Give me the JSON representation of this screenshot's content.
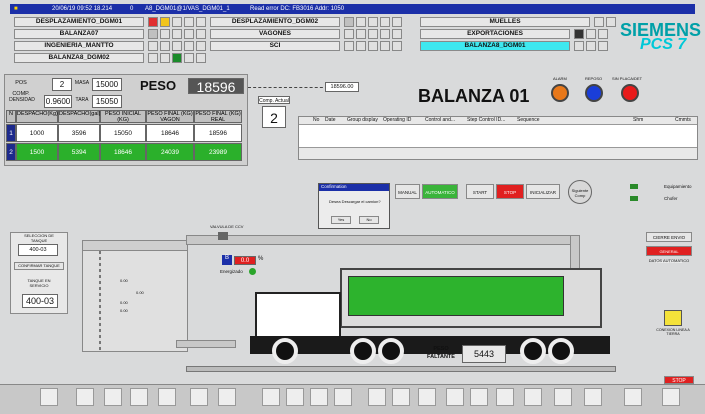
{
  "topbar": {
    "datetime": "20/06/19  09:52 18.214",
    "code": "0",
    "tag": "A8_DGM01@1/VAS_DGM01_1",
    "error": "Read error DC: FB3016 Addr: 1050"
  },
  "nav": {
    "b1": "DESPLAZAMIENTO_DGM01",
    "b2": "DESPLAZAMIENTO_DGM02",
    "b3": "MUELLES",
    "b4": "BALANZA07",
    "b5": "VAGONES",
    "b6": "EXPORTACIONES",
    "b7": "INGENIERIA_MANTTO",
    "b8": "SCI",
    "b9": "BALANZA8_DGM01",
    "b10": "BALANZA8_DGM02"
  },
  "brand": {
    "siemens": "SIEMENS",
    "pcs7": "PCS 7"
  },
  "peso_panel": {
    "pos_comp_label": "POS COMP.",
    "pos_comp_value": "2",
    "mass_label": "MASA",
    "mass_value": "15000",
    "peso_label": "PESO",
    "peso_value": "18596",
    "densidad_label": "DENSIDAD",
    "densidad_value": "0.9600",
    "tara_label": "TARA",
    "tara_value": "15050",
    "headers": [
      "N",
      "DESPACHO(Kg)",
      "DESPACHO(gal)",
      "PESO INICIAL (KG)",
      "PESO FINAL (KG) VAGON",
      "PESO FINAL (KG) REAL"
    ],
    "rows": [
      [
        "1",
        "1000",
        "3596",
        "15050",
        "18646",
        "18596"
      ],
      [
        "2",
        "1500",
        "5394",
        "18646",
        "24039",
        "23989"
      ]
    ]
  },
  "comp_actual": {
    "label": "Comp. Actual",
    "value": "2"
  },
  "title": "BALANZA 01",
  "status_lights": [
    {
      "label": "ALARM",
      "color": "#e8781a"
    },
    {
      "label": "REPOSO",
      "color": "#1a3ed8"
    },
    {
      "label": "SIN PLACA/DET",
      "color": "#e81a1a"
    }
  ],
  "readout": {
    "value": "18596.00"
  },
  "alarm_table": {
    "columns": [
      "No",
      "Date",
      "Group display",
      "Operating ID",
      "Control and...",
      "Step Control ID...",
      "Sequence",
      "Shm",
      "Cmmts"
    ]
  },
  "dialog": {
    "title": "Confirmation",
    "message": "Desea Descargar el camion?",
    "yes": "Yes",
    "no": "No"
  },
  "process_buttons": {
    "manual": "MANUAL",
    "automatic": "AUTOMATICO",
    "start": "START",
    "stop": "STOP",
    "reset": "INICIALIZAR",
    "next": "Siguiente Comp"
  },
  "side_status": {
    "equip": "Equipamiento",
    "chofer": "Chofer"
  },
  "right_buttons": {
    "cierre": "CIERRE ENVIO",
    "alert": "GENERAL PLATAFORMA",
    "auto": "DATOS AUTOMATICO"
  },
  "tank_selector": {
    "label": "SELECCION DE TANQUE",
    "value": "400-03",
    "btn": "CONFIRMAR TANQUE",
    "tank_label": "TANQUE EN SERVICIO",
    "tank_value": "400-03"
  },
  "valve": {
    "label": "VALVULA DE CCV",
    "percent": "0.0",
    "pct_sign": "%",
    "state": "Energizado"
  },
  "truck": {
    "weight_label": "PESO FALTANTE",
    "weight_value": "5443"
  },
  "tank_levels": [
    "0.00",
    "0.00",
    "0.00",
    "0.00"
  ],
  "ground": {
    "label": "CONEXION LINEA A TIERRA"
  },
  "bottom_right": {
    "label": "STOP"
  }
}
